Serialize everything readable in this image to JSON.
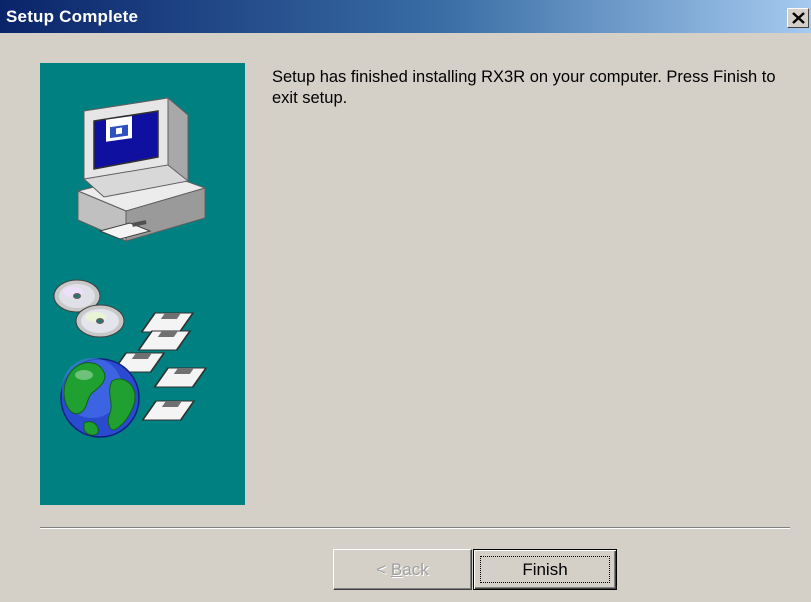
{
  "window": {
    "title": "Setup Complete",
    "close_symbol": "×"
  },
  "message": {
    "text": "Setup has finished installing RX3R on your computer. Press Finish to exit setup."
  },
  "buttons": {
    "back": {
      "prefix": "< ",
      "accel": "B",
      "rest": "ack",
      "enabled": false
    },
    "finish": {
      "label": "Finish",
      "enabled": true
    }
  },
  "sidebar": {
    "illustration": [
      "computer-icon",
      "cd-icon",
      "floppy-disk-icon",
      "globe-icon"
    ]
  },
  "colors": {
    "title_start": "#0a246a",
    "title_end": "#a6caf0",
    "panel": "#008080",
    "face": "#d4d0c8"
  }
}
